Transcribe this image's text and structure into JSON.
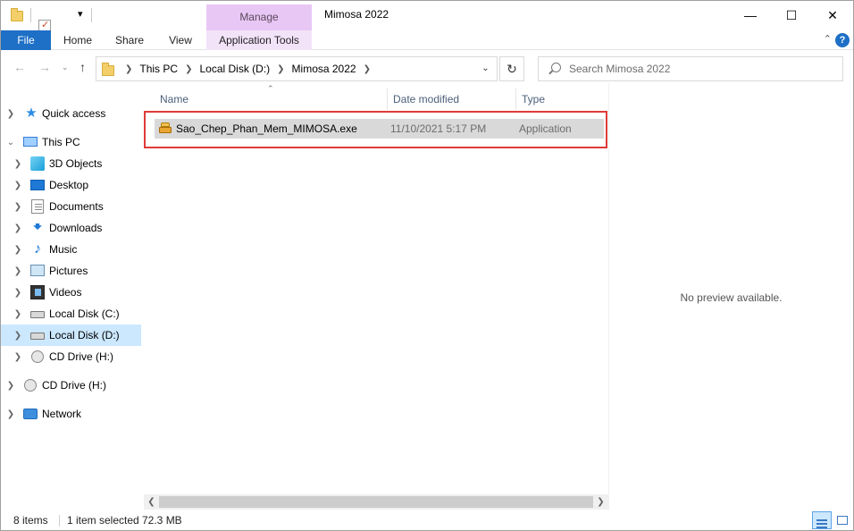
{
  "window": {
    "title": "Mimosa 2022",
    "controls": [
      "minimize",
      "maximize",
      "close"
    ]
  },
  "quick_access_toolbar": {
    "dropdown_glyph": "▾"
  },
  "contextual_tab": {
    "group_label": "Manage",
    "tab_label": "Application Tools",
    "color": "#e9c7f5"
  },
  "ribbon": {
    "tabs": [
      "File",
      "Home",
      "Share",
      "View"
    ],
    "file_color": "#1e6fc6",
    "help_glyph": "?"
  },
  "address": {
    "breadcrumbs": [
      "This PC",
      "Local Disk (D:)",
      "Mimosa 2022"
    ]
  },
  "search": {
    "placeholder": "Search Mimosa 2022"
  },
  "nav_pane": {
    "items": [
      {
        "label": "Quick access",
        "icon": "star-icon"
      },
      {
        "label": "This PC",
        "icon": "computer-icon"
      },
      {
        "label": "3D Objects",
        "icon": "cube-icon"
      },
      {
        "label": "Desktop",
        "icon": "desktop-icon"
      },
      {
        "label": "Documents",
        "icon": "document-icon"
      },
      {
        "label": "Downloads",
        "icon": "download-icon"
      },
      {
        "label": "Music",
        "icon": "music-note-icon"
      },
      {
        "label": "Pictures",
        "icon": "picture-icon"
      },
      {
        "label": "Videos",
        "icon": "film-icon"
      },
      {
        "label": "Local Disk (C:)",
        "icon": "drive-icon"
      },
      {
        "label": "Local Disk (D:)",
        "icon": "drive-icon",
        "selected": true
      },
      {
        "label": "CD Drive (H:)",
        "icon": "cd-drive-icon"
      },
      {
        "label": "CD Drive (H:)",
        "icon": "cd-drive-icon"
      },
      {
        "label": "Network",
        "icon": "network-icon"
      }
    ]
  },
  "file_list": {
    "columns": [
      "Name",
      "Date modified",
      "Type"
    ],
    "rows": [
      {
        "name": "Sao_Chep_Phan_Mem_MIMOSA.exe",
        "date_modified": "11/10/2021 5:17 PM",
        "type": "Application",
        "icon": "application-icon",
        "selected": true
      }
    ],
    "highlight_color": "#e03a3a"
  },
  "preview": {
    "text": "No preview available."
  },
  "status_bar": {
    "item_count": "8 items",
    "selection": "1 item selected",
    "size": "72.3 MB"
  }
}
